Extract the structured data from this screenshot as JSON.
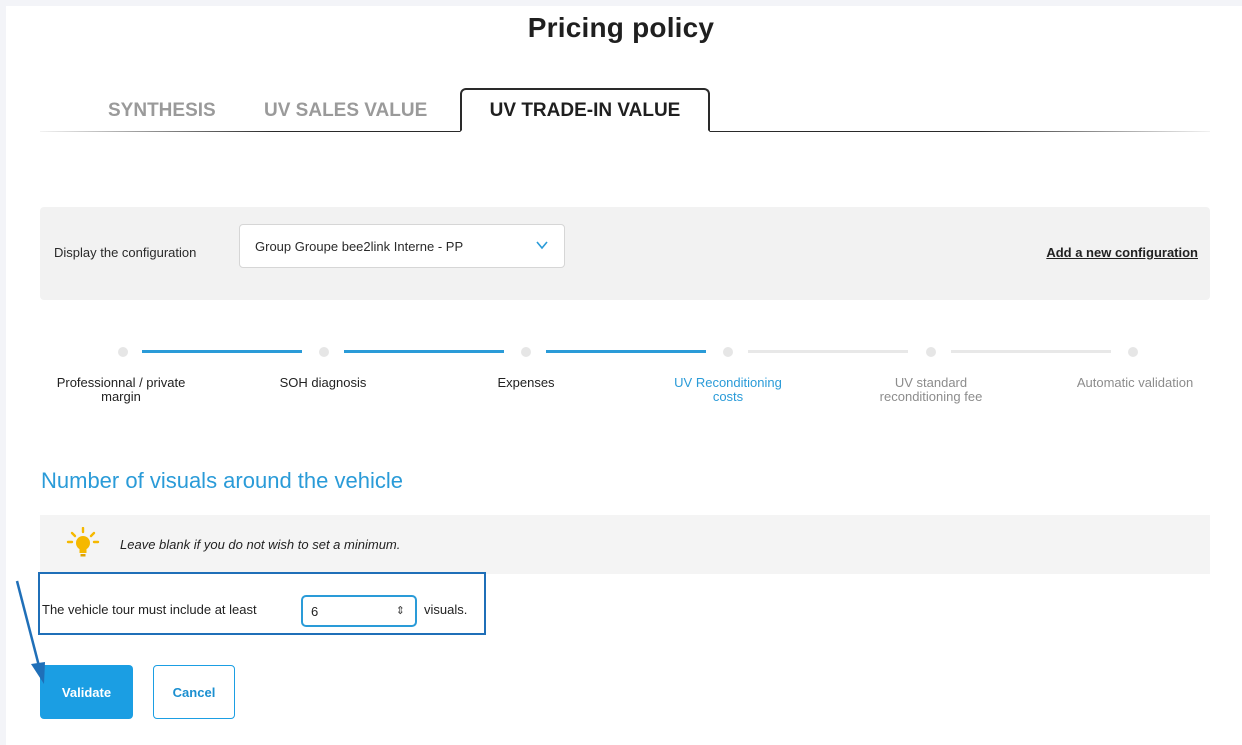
{
  "page": {
    "title": "Pricing policy"
  },
  "tabs": [
    {
      "label": "SYNTHESIS",
      "active": false
    },
    {
      "label": "UV SALES VALUE",
      "active": false
    },
    {
      "label": "UV TRADE-IN VALUE",
      "active": true
    }
  ],
  "config": {
    "label": "Display the configuration",
    "selected": "Group Groupe bee2link Interne - PP",
    "add_link": "Add a new configuration"
  },
  "steps": [
    {
      "label": "Professionnal / private margin",
      "state": "done"
    },
    {
      "label": "SOH diagnosis",
      "state": "done"
    },
    {
      "label": "Expenses",
      "state": "done"
    },
    {
      "label": "UV Reconditioning costs",
      "state": "current"
    },
    {
      "label": "UV standard reconditioning fee",
      "state": "future"
    },
    {
      "label": "Automatic validation",
      "state": "future"
    }
  ],
  "section": {
    "title": "Number of visuals around the vehicle",
    "hint": "Leave blank if you do not wish to set a minimum.",
    "prefix": "The vehicle tour must include at least",
    "value": "6",
    "suffix": "visuals."
  },
  "buttons": {
    "validate": "Validate",
    "cancel": "Cancel"
  },
  "colors": {
    "accent": "#2a9bd8",
    "button": "#1b9ee3",
    "highlight": "#1f6fb8"
  },
  "icons": {
    "hint": "lightbulb-icon",
    "select": "chevron-down-icon",
    "spinner": "spinner-arrows-icon"
  }
}
